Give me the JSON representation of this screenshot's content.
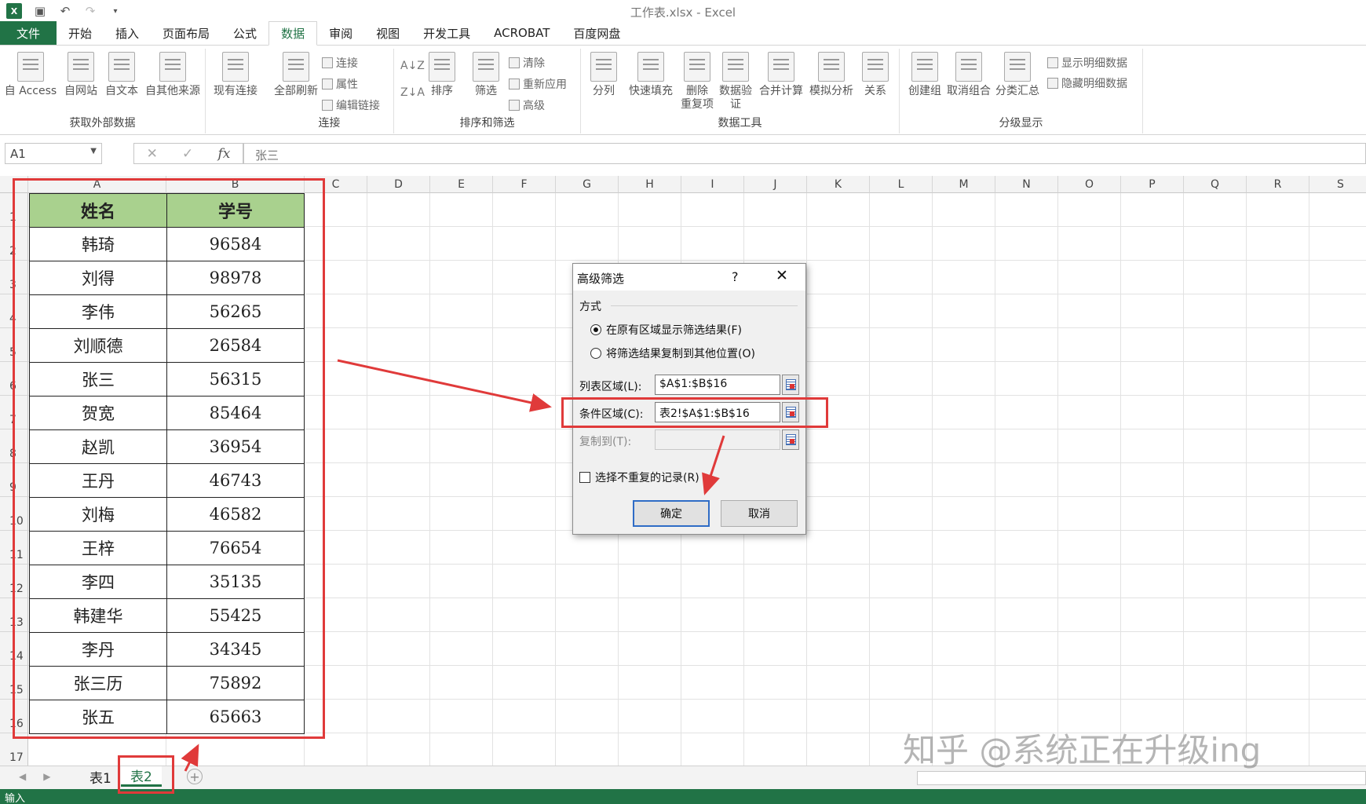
{
  "window": {
    "title": "工作表.xlsx - Excel",
    "logo": "X"
  },
  "qat": {
    "icons": [
      "save-icon",
      "undo-icon",
      "redo-icon",
      "customize-icon"
    ]
  },
  "tabs": [
    "文件",
    "开始",
    "插入",
    "页面布局",
    "公式",
    "数据",
    "审阅",
    "视图",
    "开发工具",
    "ACROBAT",
    "百度网盘"
  ],
  "active_tab": "数据",
  "ribbon": {
    "groups": [
      "获取外部数据",
      "连接",
      "排序和筛选",
      "数据工具",
      "分级显示"
    ],
    "external": [
      "自 Access",
      "自网站",
      "自文本",
      "自其他来源",
      "现有连接"
    ],
    "connect": {
      "refresh": "全部刷新",
      "small": [
        "连接",
        "属性",
        "编辑链接"
      ]
    },
    "sort": {
      "sort": "排序",
      "filter": "筛选",
      "small": [
        "清除",
        "重新应用",
        "高级"
      ]
    },
    "tools": [
      "分列",
      "快速填充",
      "删除\n重复项",
      "数据验\n证",
      "合并计算",
      "模拟分析",
      "关系"
    ],
    "outline": {
      "big": [
        "创建组",
        "取消组合",
        "分类汇总"
      ],
      "small": [
        "显示明细数据",
        "隐藏明细数据"
      ]
    }
  },
  "formula": {
    "namebox": "A1",
    "cancel": "✕",
    "enter": "✓",
    "fx": "fx",
    "content": "张三"
  },
  "columns": [
    "A",
    "B",
    "C",
    "D",
    "E",
    "F",
    "G",
    "H",
    "I",
    "J",
    "K",
    "L",
    "M",
    "N",
    "O",
    "P",
    "Q",
    "R",
    "S"
  ],
  "rows": [
    "1",
    "2",
    "3",
    "4",
    "5",
    "6",
    "7",
    "8",
    "9",
    "10",
    "11",
    "12",
    "13",
    "14",
    "15",
    "16",
    "17"
  ],
  "table": {
    "headers": [
      "姓名",
      "学号"
    ],
    "rows": [
      [
        "韩琦",
        "96584"
      ],
      [
        "刘得",
        "98978"
      ],
      [
        "李伟",
        "56265"
      ],
      [
        "刘顺德",
        "26584"
      ],
      [
        "张三",
        "56315"
      ],
      [
        "贺宽",
        "85464"
      ],
      [
        "赵凯",
        "36954"
      ],
      [
        "王丹",
        "46743"
      ],
      [
        "刘梅",
        "46582"
      ],
      [
        "王梓",
        "76654"
      ],
      [
        "李四",
        "35135"
      ],
      [
        "韩建华",
        "55425"
      ],
      [
        "李丹",
        "34345"
      ],
      [
        "张三历",
        "75892"
      ],
      [
        "张五",
        "65663"
      ]
    ]
  },
  "dialog": {
    "title": "高级筛选",
    "help": "?",
    "close": "✕",
    "section": "方式",
    "radio1": "在原有区域显示筛选结果(F)",
    "radio2": "将筛选结果复制到其他位置(O)",
    "list_label": "列表区域(L):",
    "list_value": "$A$1:$B$16",
    "criteria_label": "条件区域(C):",
    "criteria_value": "表2!$A$1:$B$16",
    "copy_label": "复制到(T):",
    "copy_value": "",
    "unique_label": "选择不重复的记录(R)",
    "ok": "确定",
    "cancel": "取消"
  },
  "sheets": [
    "表1",
    "表2"
  ],
  "active_sheet": "表2",
  "status": {
    "mode": "输入"
  },
  "watermark": "知乎 @系统正在升级ing",
  "colors": {
    "excel_green": "#217346",
    "header_fill": "#a9d18e",
    "annotation_red": "#e03a3a",
    "ok_border": "#2f6cc6"
  }
}
